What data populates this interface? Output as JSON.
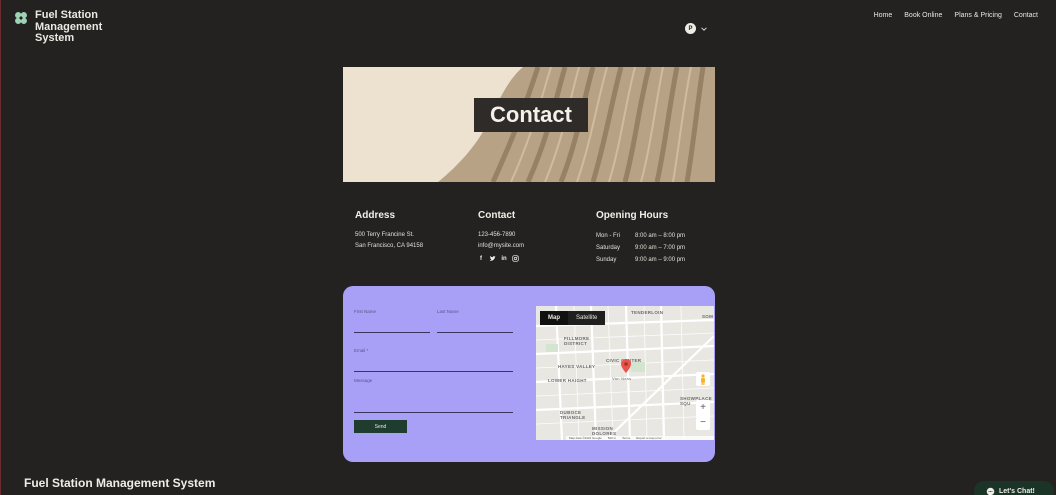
{
  "brand": {
    "name_lines": [
      "Fuel Station",
      "Management",
      "System"
    ],
    "avatar_initial": "P"
  },
  "nav": {
    "items": [
      "Home",
      "Book Online",
      "Plans & Pricing",
      "Contact"
    ]
  },
  "hero": {
    "title": "Contact"
  },
  "address": {
    "heading": "Address",
    "line1": "500 Terry Francine St.",
    "line2": "San Francisco, CA 94158"
  },
  "contact": {
    "heading": "Contact",
    "phone": "123-456-7890",
    "email": "info@mysite.com",
    "socials": [
      "facebook-icon",
      "twitter-icon",
      "linkedin-icon",
      "instagram-icon"
    ]
  },
  "hours": {
    "heading": "Opening Hours",
    "rows": [
      {
        "day": "Mon - Fri",
        "time": "8:00 am – 8:00 pm"
      },
      {
        "day": "Saturday",
        "time": "9:00 am – 7:00 pm"
      },
      {
        "day": "Sunday",
        "time": "9:00 am – 9:00 pm"
      }
    ]
  },
  "form": {
    "first_name": "First Name",
    "last_name": "Last Name",
    "email": "Email *",
    "message": "Message",
    "send": "Send"
  },
  "map": {
    "tab_map": "Map",
    "tab_satellite": "Satellite",
    "labels": {
      "tenderloin": "TENDERLOIN",
      "fillmore": "FILLMORE DISTRICT",
      "civic": "CIVIC CENTER",
      "hayes": "HAYES VALLEY",
      "lower_haight": "LOWER HAIGHT",
      "duboce": "DUBOCE TRIANGLE",
      "mission": "MISSION DOLORES",
      "soma": "SOM",
      "showplace": "SHOWPLACE SQU",
      "van_ness": "Van Ness"
    },
    "footer": [
      "Map data ©2024 Google",
      "500 m",
      "Terms",
      "Report a map error"
    ],
    "zoom_in": "+",
    "zoom_out": "−"
  },
  "footer": {
    "title": "Fuel Station Management System"
  },
  "chat": {
    "label": "Let's Chat!"
  },
  "colors": {
    "background": "#242220",
    "form_card": "#a7a0f6",
    "send_button": "#1f3d2f",
    "logo_accent": "#9fd3b5"
  }
}
